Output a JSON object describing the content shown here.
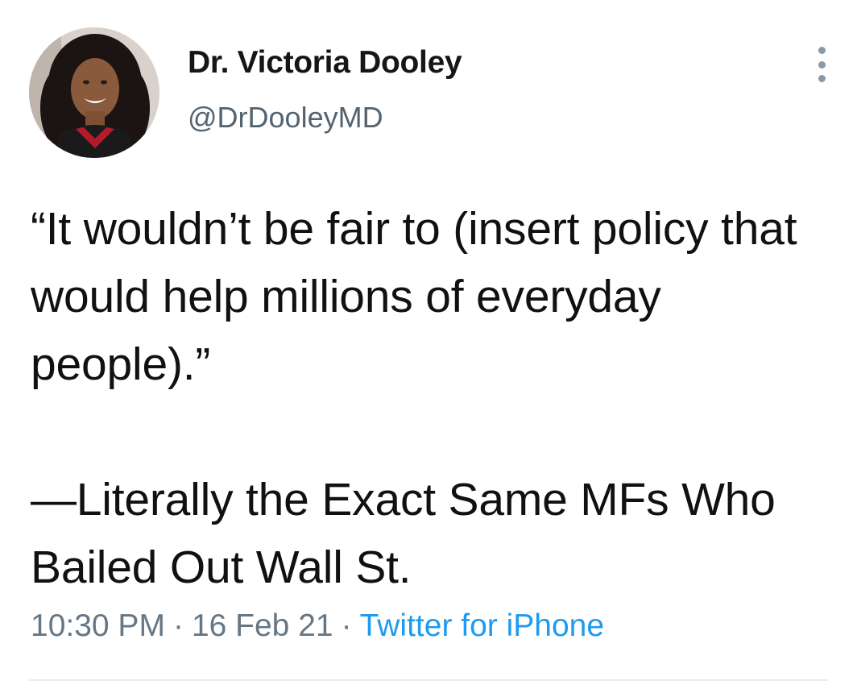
{
  "author": {
    "display_name": "Dr. Victoria Dooley",
    "handle": "@DrDooleyMD",
    "avatar_icon": "profile-photo"
  },
  "tweet": {
    "lines": [
      "“It wouldn’t be fair to (insert policy that would help millions of everyday people).”",
      "",
      "—Literally the Exact Same MFs Who Bailed Out Wall St."
    ]
  },
  "meta": {
    "time": "10:30 PM",
    "separator": "·",
    "date": "16 Feb 21",
    "source": "Twitter for iPhone"
  },
  "icons": {
    "more": "more-vertical-icon"
  },
  "colors": {
    "text": "#14171a",
    "secondary": "#657786",
    "link": "#1d9bf0",
    "divider": "#e6ecf0"
  }
}
